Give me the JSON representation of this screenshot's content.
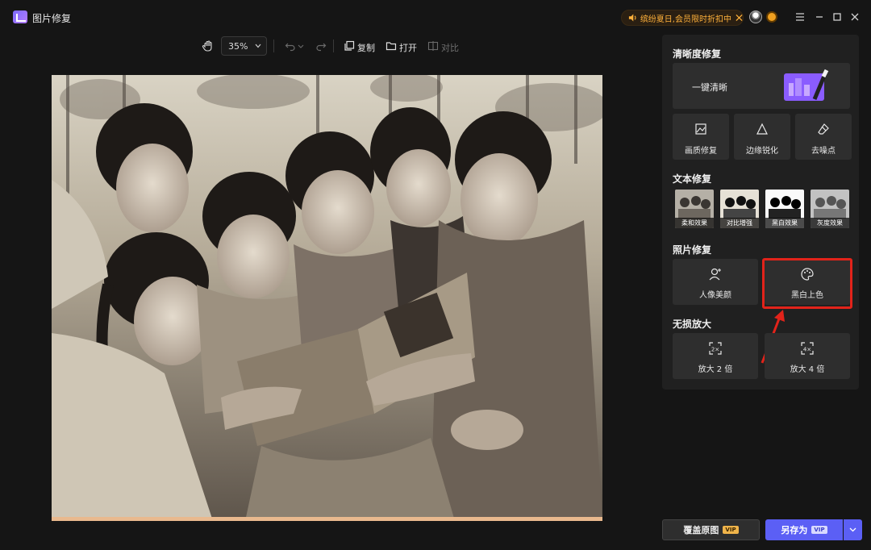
{
  "app": {
    "title": "图片修复"
  },
  "promo": {
    "text": "缤纷夏日,会员限时折扣中"
  },
  "toolbar": {
    "zoom": "35%",
    "copy_label": "复制",
    "open_label": "打开",
    "compare_label": "对比"
  },
  "panel": {
    "clarity": {
      "title": "清晰度修复",
      "one_click": "一键清晰",
      "items": [
        {
          "label": "画质修复",
          "icon": "image-quality-icon"
        },
        {
          "label": "边缘锐化",
          "icon": "sharpen-icon"
        },
        {
          "label": "去噪点",
          "icon": "eraser-icon"
        }
      ]
    },
    "text_repair": {
      "title": "文本修复",
      "items": [
        {
          "label": "柔和效果"
        },
        {
          "label": "对比增强"
        },
        {
          "label": "黑白效果"
        },
        {
          "label": "灰度效果"
        }
      ]
    },
    "photo_repair": {
      "title": "照片修复",
      "items": [
        {
          "label": "人像美颜",
          "icon": "portrait-icon"
        },
        {
          "label": "黑白上色",
          "icon": "palette-icon"
        }
      ]
    },
    "upscale": {
      "title": "无损放大",
      "items": [
        {
          "label": "放大 2 倍",
          "icon_text": "2×"
        },
        {
          "label": "放大 4 倍",
          "icon_text": "4×"
        }
      ]
    }
  },
  "footer": {
    "cover_label": "覆盖原图",
    "save_as_label": "另存为",
    "vip": "VIP"
  },
  "colors": {
    "accent": "#5b5ff5",
    "promo": "#ffb13b",
    "highlight": "#e2231a"
  }
}
